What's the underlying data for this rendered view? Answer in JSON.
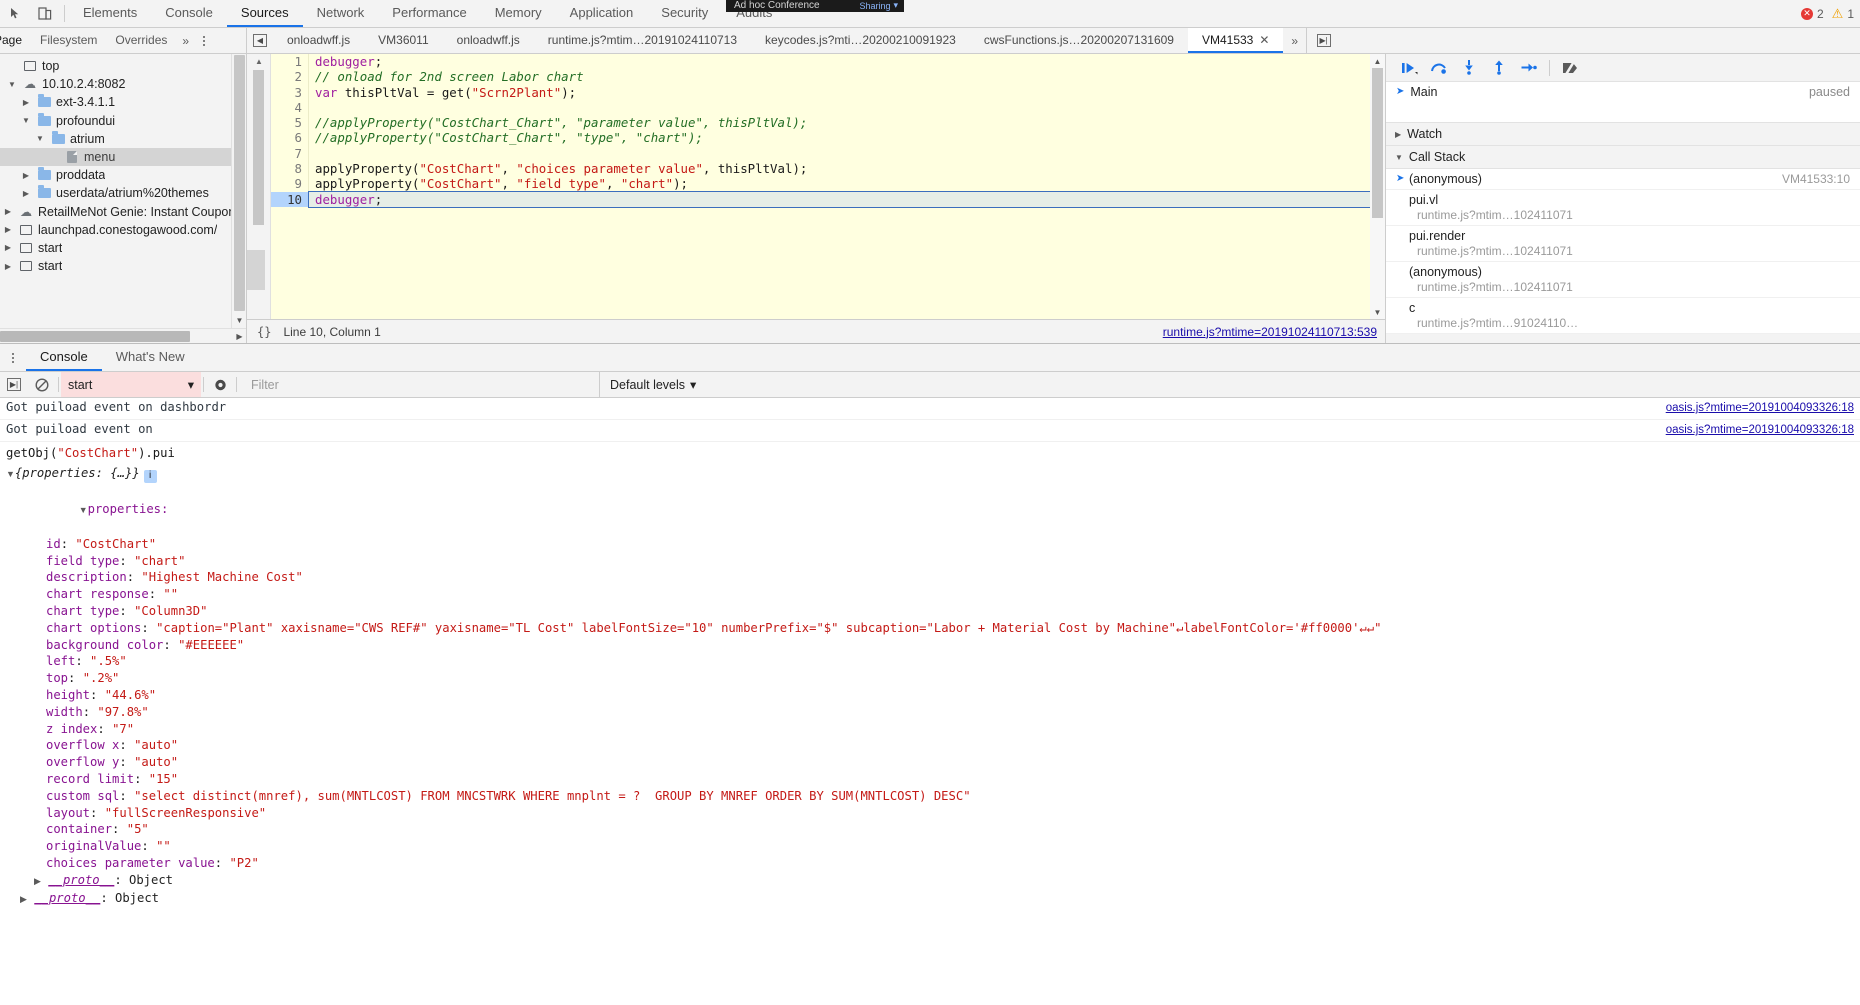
{
  "main_toolbar": {
    "panel_tabs": [
      {
        "label": "Elements",
        "active": false
      },
      {
        "label": "Console",
        "active": false
      },
      {
        "label": "Sources",
        "active": true
      },
      {
        "label": "Network",
        "active": false
      },
      {
        "label": "Performance",
        "active": false
      },
      {
        "label": "Memory",
        "active": false
      },
      {
        "label": "Application",
        "active": false
      },
      {
        "label": "Security",
        "active": false
      },
      {
        "label": "Audits",
        "active": false
      }
    ],
    "error_count": "2",
    "warning_count": "1"
  },
  "overlay_banner": {
    "title": "Ad hoc Conference",
    "status": "Sharing"
  },
  "sources_toolbar": {
    "nav_tabs": [
      {
        "label": "Page",
        "active": true
      },
      {
        "label": "Filesystem",
        "active": false
      },
      {
        "label": "Overrides",
        "active": false
      }
    ],
    "more_tabs": "»",
    "editor_tabs": [
      {
        "label": "onloadwff.js",
        "active": false,
        "closable": false
      },
      {
        "label": "VM36011",
        "active": false,
        "closable": false
      },
      {
        "label": "onloadwff.js",
        "active": false,
        "closable": false
      },
      {
        "label": "runtime.js?mtim…20191024110713",
        "active": false,
        "closable": false
      },
      {
        "label": "keycodes.js?mti…20200210091923",
        "active": false,
        "closable": false
      },
      {
        "label": "cwsFunctions.js…20200207131609",
        "active": false,
        "closable": false
      },
      {
        "label": "VM41533",
        "active": true,
        "closable": true
      }
    ],
    "tabs_overflow": "»"
  },
  "navigator": {
    "tree": [
      {
        "label": "top",
        "depth": 0,
        "twisty": "",
        "icon": "frame-icon",
        "selected": false
      },
      {
        "label": "10.10.2.4:8082",
        "depth": 0,
        "twisty": "▼",
        "icon": "cloud-icon",
        "selected": false
      },
      {
        "label": "ext-3.4.1.1",
        "depth": 1,
        "twisty": "▶",
        "icon": "folder-icon",
        "selected": false
      },
      {
        "label": "profoundui",
        "depth": 1,
        "twisty": "▼",
        "icon": "folder-icon",
        "selected": false
      },
      {
        "label": "atrium",
        "depth": 2,
        "twisty": "▼",
        "icon": "folder-icon",
        "selected": false
      },
      {
        "label": "menu",
        "depth": 3,
        "twisty": "",
        "icon": "file-icon",
        "selected": true
      },
      {
        "label": "proddata",
        "depth": 1,
        "twisty": "▶",
        "icon": "folder-icon",
        "selected": false
      },
      {
        "label": "userdata/atrium%20themes",
        "depth": 1,
        "twisty": "▶",
        "icon": "folder-icon",
        "selected": false
      },
      {
        "label": "RetailMeNot Genie: Instant Coupons",
        "depth": 0,
        "twisty": "▶",
        "icon": "cloud-icon",
        "selected": false
      },
      {
        "label": "launchpad.conestogawood.com/",
        "depth": 0,
        "twisty": "▶",
        "icon": "frame-icon",
        "selected": false
      },
      {
        "label": "start",
        "depth": 0,
        "twisty": "▶",
        "icon": "frame-icon",
        "selected": false
      },
      {
        "label": "start",
        "depth": 0,
        "twisty": "▶",
        "icon": "frame-icon",
        "selected": false
      }
    ]
  },
  "editor": {
    "lines": [
      {
        "n": "1",
        "tokens": [
          {
            "t": "debugger",
            "c": "kw"
          },
          {
            "t": ";",
            "c": "pl"
          }
        ],
        "current": false
      },
      {
        "n": "2",
        "tokens": [
          {
            "t": "// onload for 2nd screen Labor chart",
            "c": "cm"
          }
        ],
        "current": false
      },
      {
        "n": "3",
        "tokens": [
          {
            "t": "var",
            "c": "kw"
          },
          {
            "t": " thisPltVal = get(",
            "c": "pl"
          },
          {
            "t": "\"Scrn2Plant\"",
            "c": "str"
          },
          {
            "t": ");",
            "c": "pl"
          }
        ],
        "current": false
      },
      {
        "n": "4",
        "tokens": [],
        "current": false
      },
      {
        "n": "5",
        "tokens": [
          {
            "t": "//applyProperty(\"CostChart_Chart\", \"parameter value\", thisPltVal);",
            "c": "cm"
          }
        ],
        "current": false
      },
      {
        "n": "6",
        "tokens": [
          {
            "t": "//applyProperty(\"CostChart_Chart\", \"type\", \"chart\");",
            "c": "cm"
          }
        ],
        "current": false
      },
      {
        "n": "7",
        "tokens": [],
        "current": false
      },
      {
        "n": "8",
        "tokens": [
          {
            "t": "applyProperty(",
            "c": "pl"
          },
          {
            "t": "\"CostChart\"",
            "c": "str"
          },
          {
            "t": ", ",
            "c": "pl"
          },
          {
            "t": "\"choices parameter value\"",
            "c": "str"
          },
          {
            "t": ", thisPltVal);",
            "c": "pl"
          }
        ],
        "current": false
      },
      {
        "n": "9",
        "tokens": [
          {
            "t": "applyProperty(",
            "c": "pl"
          },
          {
            "t": "\"CostChart\"",
            "c": "str"
          },
          {
            "t": ", ",
            "c": "pl"
          },
          {
            "t": "\"field type\"",
            "c": "str"
          },
          {
            "t": ", ",
            "c": "pl"
          },
          {
            "t": "\"chart\"",
            "c": "str"
          },
          {
            "t": ");",
            "c": "pl"
          }
        ],
        "current": false
      },
      {
        "n": "10",
        "tokens": [
          {
            "t": "debugger",
            "c": "kw"
          },
          {
            "t": ";",
            "c": "pl"
          }
        ],
        "current": true
      }
    ],
    "status": {
      "format_icon": "{}",
      "position": "Line 10, Column 1",
      "source_link": "runtime.js?mtime=20191024110713:539"
    }
  },
  "debugger": {
    "toolbar_buttons": [
      {
        "name": "resume-script-execution",
        "glyph": "▶"
      },
      {
        "name": "step-over-next-function-call",
        "glyph": "↷"
      },
      {
        "name": "step-into-next-function-call",
        "glyph": "↓"
      },
      {
        "name": "step-out-of-current-function",
        "glyph": "↑"
      },
      {
        "name": "step",
        "glyph": "→"
      },
      {
        "name": "deactivate-breakpoints",
        "glyph": "◧"
      }
    ],
    "thread": {
      "name": "Main",
      "state": "paused"
    },
    "watch": {
      "label": "Watch",
      "expanded": false
    },
    "call_stack": {
      "label": "Call Stack",
      "expanded": true,
      "frames": [
        {
          "name": "(anonymous)",
          "location": "VM41533:10",
          "selected": true,
          "inline": true
        },
        {
          "name": "pui.vl",
          "location": "runtime.js?mtim…102411071",
          "selected": false,
          "inline": false
        },
        {
          "name": "pui.render",
          "location": "runtime.js?mtim…102411071",
          "selected": false,
          "inline": false
        },
        {
          "name": "(anonymous)",
          "location": "runtime.js?mtim…102411071",
          "selected": false,
          "inline": false
        },
        {
          "name": "c",
          "location": "runtime.js?mtim…91024110…",
          "selected": false,
          "inline": false
        }
      ]
    }
  },
  "drawer": {
    "tabs": [
      {
        "label": "Console",
        "active": true
      },
      {
        "label": "What's New",
        "active": false
      }
    ],
    "console_toolbar": {
      "context": "start",
      "filter_value": "",
      "filter_placeholder": "Filter",
      "levels": "Default levels",
      "levels_caret": "▼"
    },
    "messages": [
      {
        "type": "log",
        "text": "Got puiload event on dashbordr",
        "source": "oasis.js?mtime=20191004093326:18"
      },
      {
        "type": "log",
        "text": "Got puiload event on",
        "source": "oasis.js?mtime=20191004093326:18"
      }
    ],
    "command": "getObj(\"CostChart\").pui",
    "result_header": "{properties: {…}}",
    "result_badge": "i",
    "properties_label": "properties:",
    "properties": [
      {
        "key": "id",
        "value": "\"CostChart\""
      },
      {
        "key": "field type",
        "value": "\"chart\""
      },
      {
        "key": "description",
        "value": "\"Highest Machine Cost\""
      },
      {
        "key": "chart response",
        "value": "\"\""
      },
      {
        "key": "chart type",
        "value": "\"Column3D\""
      },
      {
        "key": "chart options",
        "value": "\"caption=\"Plant\" xaxisname=\"CWS REF#\" yaxisname=\"TL Cost\" labelFontSize=\"10\" numberPrefix=\"$\" subcaption=\"Labor + Material Cost by Machine\"↵labelFontColor='#ff0000'↵↵\""
      },
      {
        "key": "background color",
        "value": "\"#EEEEEE\""
      },
      {
        "key": "left",
        "value": "\".5%\""
      },
      {
        "key": "top",
        "value": "\".2%\""
      },
      {
        "key": "height",
        "value": "\"44.6%\""
      },
      {
        "key": "width",
        "value": "\"97.8%\""
      },
      {
        "key": "z index",
        "value": "\"7\""
      },
      {
        "key": "overflow x",
        "value": "\"auto\""
      },
      {
        "key": "overflow y",
        "value": "\"auto\""
      },
      {
        "key": "record limit",
        "value": "\"15\""
      },
      {
        "key": "custom sql",
        "value": "\"select distinct(mnref), sum(MNTLCOST) FROM MNCSTWRK WHERE mnplnt = ?  GROUP BY MNREF ORDER BY SUM(MNTLCOST) DESC\""
      },
      {
        "key": "layout",
        "value": "\"fullScreenResponsive\""
      },
      {
        "key": "container",
        "value": "\"5\""
      },
      {
        "key": "originalValue",
        "value": "\"\""
      },
      {
        "key": "choices parameter value",
        "value": "\"P2\""
      }
    ],
    "proto_inner": {
      "label": "__proto__",
      "value": "Object"
    },
    "proto_outer": {
      "label": "__proto__",
      "value": "Object"
    }
  },
  "colors": {
    "accent": "#1a73e8",
    "editor_bg": "#ffffe0",
    "string": "#c41a16",
    "comment": "#236e25",
    "keyword": "#a020a0",
    "prop_name": "#881391",
    "link": "#1a0dab",
    "context_warn_bg": "#fbdede"
  }
}
